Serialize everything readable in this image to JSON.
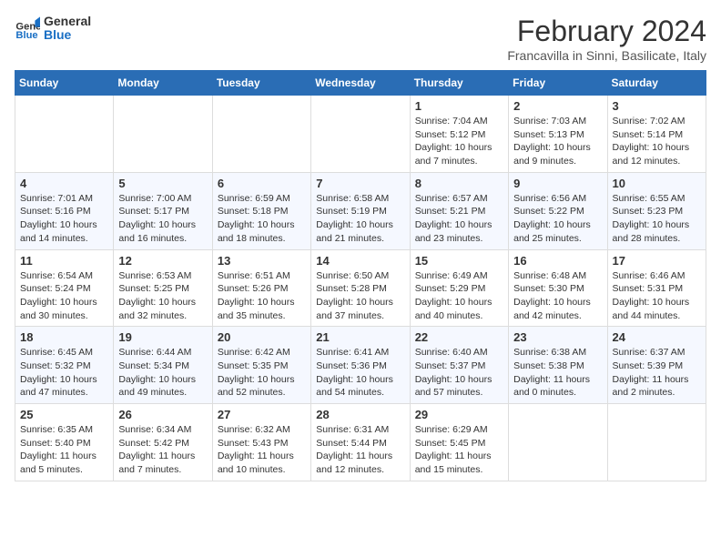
{
  "logo": {
    "general": "General",
    "blue": "Blue"
  },
  "header": {
    "month": "February 2024",
    "location": "Francavilla in Sinni, Basilicate, Italy"
  },
  "days_of_week": [
    "Sunday",
    "Monday",
    "Tuesday",
    "Wednesday",
    "Thursday",
    "Friday",
    "Saturday"
  ],
  "weeks": [
    [
      {
        "day": "",
        "info": ""
      },
      {
        "day": "",
        "info": ""
      },
      {
        "day": "",
        "info": ""
      },
      {
        "day": "",
        "info": ""
      },
      {
        "day": "1",
        "info": "Sunrise: 7:04 AM\nSunset: 5:12 PM\nDaylight: 10 hours\nand 7 minutes."
      },
      {
        "day": "2",
        "info": "Sunrise: 7:03 AM\nSunset: 5:13 PM\nDaylight: 10 hours\nand 9 minutes."
      },
      {
        "day": "3",
        "info": "Sunrise: 7:02 AM\nSunset: 5:14 PM\nDaylight: 10 hours\nand 12 minutes."
      }
    ],
    [
      {
        "day": "4",
        "info": "Sunrise: 7:01 AM\nSunset: 5:16 PM\nDaylight: 10 hours\nand 14 minutes."
      },
      {
        "day": "5",
        "info": "Sunrise: 7:00 AM\nSunset: 5:17 PM\nDaylight: 10 hours\nand 16 minutes."
      },
      {
        "day": "6",
        "info": "Sunrise: 6:59 AM\nSunset: 5:18 PM\nDaylight: 10 hours\nand 18 minutes."
      },
      {
        "day": "7",
        "info": "Sunrise: 6:58 AM\nSunset: 5:19 PM\nDaylight: 10 hours\nand 21 minutes."
      },
      {
        "day": "8",
        "info": "Sunrise: 6:57 AM\nSunset: 5:21 PM\nDaylight: 10 hours\nand 23 minutes."
      },
      {
        "day": "9",
        "info": "Sunrise: 6:56 AM\nSunset: 5:22 PM\nDaylight: 10 hours\nand 25 minutes."
      },
      {
        "day": "10",
        "info": "Sunrise: 6:55 AM\nSunset: 5:23 PM\nDaylight: 10 hours\nand 28 minutes."
      }
    ],
    [
      {
        "day": "11",
        "info": "Sunrise: 6:54 AM\nSunset: 5:24 PM\nDaylight: 10 hours\nand 30 minutes."
      },
      {
        "day": "12",
        "info": "Sunrise: 6:53 AM\nSunset: 5:25 PM\nDaylight: 10 hours\nand 32 minutes."
      },
      {
        "day": "13",
        "info": "Sunrise: 6:51 AM\nSunset: 5:26 PM\nDaylight: 10 hours\nand 35 minutes."
      },
      {
        "day": "14",
        "info": "Sunrise: 6:50 AM\nSunset: 5:28 PM\nDaylight: 10 hours\nand 37 minutes."
      },
      {
        "day": "15",
        "info": "Sunrise: 6:49 AM\nSunset: 5:29 PM\nDaylight: 10 hours\nand 40 minutes."
      },
      {
        "day": "16",
        "info": "Sunrise: 6:48 AM\nSunset: 5:30 PM\nDaylight: 10 hours\nand 42 minutes."
      },
      {
        "day": "17",
        "info": "Sunrise: 6:46 AM\nSunset: 5:31 PM\nDaylight: 10 hours\nand 44 minutes."
      }
    ],
    [
      {
        "day": "18",
        "info": "Sunrise: 6:45 AM\nSunset: 5:32 PM\nDaylight: 10 hours\nand 47 minutes."
      },
      {
        "day": "19",
        "info": "Sunrise: 6:44 AM\nSunset: 5:34 PM\nDaylight: 10 hours\nand 49 minutes."
      },
      {
        "day": "20",
        "info": "Sunrise: 6:42 AM\nSunset: 5:35 PM\nDaylight: 10 hours\nand 52 minutes."
      },
      {
        "day": "21",
        "info": "Sunrise: 6:41 AM\nSunset: 5:36 PM\nDaylight: 10 hours\nand 54 minutes."
      },
      {
        "day": "22",
        "info": "Sunrise: 6:40 AM\nSunset: 5:37 PM\nDaylight: 10 hours\nand 57 minutes."
      },
      {
        "day": "23",
        "info": "Sunrise: 6:38 AM\nSunset: 5:38 PM\nDaylight: 11 hours\nand 0 minutes."
      },
      {
        "day": "24",
        "info": "Sunrise: 6:37 AM\nSunset: 5:39 PM\nDaylight: 11 hours\nand 2 minutes."
      }
    ],
    [
      {
        "day": "25",
        "info": "Sunrise: 6:35 AM\nSunset: 5:40 PM\nDaylight: 11 hours\nand 5 minutes."
      },
      {
        "day": "26",
        "info": "Sunrise: 6:34 AM\nSunset: 5:42 PM\nDaylight: 11 hours\nand 7 minutes."
      },
      {
        "day": "27",
        "info": "Sunrise: 6:32 AM\nSunset: 5:43 PM\nDaylight: 11 hours\nand 10 minutes."
      },
      {
        "day": "28",
        "info": "Sunrise: 6:31 AM\nSunset: 5:44 PM\nDaylight: 11 hours\nand 12 minutes."
      },
      {
        "day": "29",
        "info": "Sunrise: 6:29 AM\nSunset: 5:45 PM\nDaylight: 11 hours\nand 15 minutes."
      },
      {
        "day": "",
        "info": ""
      },
      {
        "day": "",
        "info": ""
      }
    ]
  ]
}
